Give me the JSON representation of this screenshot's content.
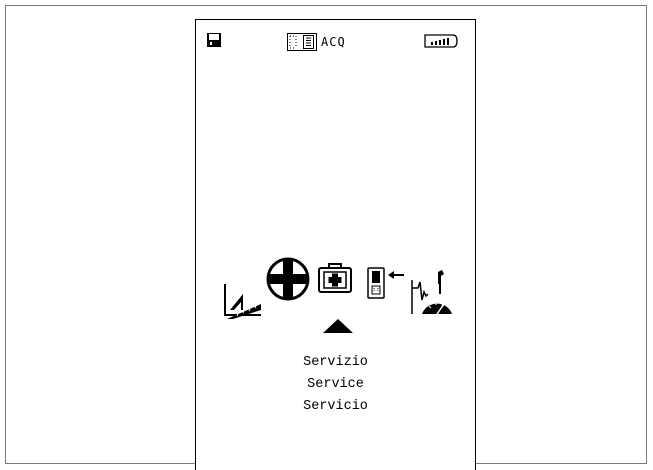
{
  "header": {
    "mode_label": "ACQ",
    "icons": [
      "save-icon",
      "layout-icon",
      "battery-icon"
    ]
  },
  "menu": {
    "items": [
      {
        "name": "measure-icon"
      },
      {
        "name": "target-icon"
      },
      {
        "name": "service-icon",
        "selected": true
      },
      {
        "name": "transfer-icon"
      },
      {
        "name": "tools-icon"
      }
    ],
    "selected_index": 2
  },
  "caption": {
    "italian": "Servizio",
    "english": "Service",
    "spanish": "Servicio"
  },
  "colors": {
    "foreground": "#000000",
    "background": "#ffffff"
  }
}
